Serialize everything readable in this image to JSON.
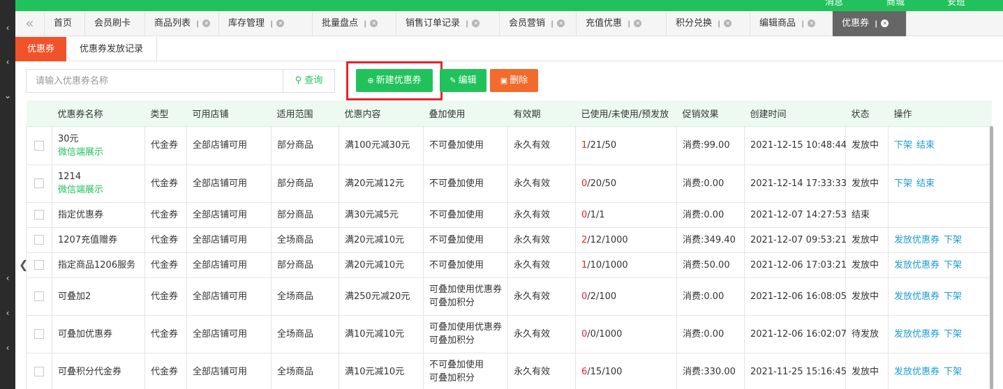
{
  "topbar": {
    "items": [
      "消息",
      "商城",
      "安班"
    ]
  },
  "tabs": [
    {
      "label": "首页",
      "closable": false
    },
    {
      "label": "会员刷卡",
      "closable": false
    },
    {
      "label": "商品列表",
      "closable": true
    },
    {
      "label": "库存管理",
      "closable": true
    },
    {
      "label": "批量盘点",
      "closable": true
    },
    {
      "label": "销售订单记录",
      "closable": true
    },
    {
      "label": "会员营销",
      "closable": true
    },
    {
      "label": "充值优惠",
      "closable": true
    },
    {
      "label": "积分兑换",
      "closable": true
    },
    {
      "label": "编辑商品",
      "closable": true
    },
    {
      "label": "优惠券",
      "closable": true,
      "active": true
    }
  ],
  "subtabs": [
    "优惠券",
    "优惠券发放记录"
  ],
  "search": {
    "placeholder": "请输入优惠券名称",
    "button": "查询"
  },
  "actions": {
    "create": "新建优惠券",
    "edit": "编辑",
    "delete": "删除"
  },
  "colors": {
    "green": "#21c25c",
    "orange": "#f26b2c",
    "red": "#e8242c",
    "link": "#1a9bd7"
  },
  "table": {
    "headers": [
      "优惠券名称",
      "类型",
      "可用店铺",
      "适用范围",
      "优惠内容",
      "叠加使用",
      "有效期",
      "已使用/未使用/预发放",
      "促销效果",
      "创建时间",
      "状态",
      "操作"
    ],
    "rows": [
      {
        "name": "30元",
        "sub": "微信端展示",
        "type": "代金券",
        "store": "全部店铺可用",
        "scope": "部分商品",
        "content": "满100元减30元",
        "stack": [
          "不可叠加使用"
        ],
        "validity": "永久有效",
        "used": "1",
        "rest": "/21/50",
        "effect": "消费:99.00",
        "created": "2021-12-15 10:48:44",
        "status": "发放中",
        "ops": [
          "下架",
          "结束"
        ]
      },
      {
        "name": "1214",
        "sub": "微信端展示",
        "type": "代金券",
        "store": "全部店铺可用",
        "scope": "部分商品",
        "content": "满20元减12元",
        "stack": [
          "不可叠加使用"
        ],
        "validity": "永久有效",
        "used": "0",
        "rest": "/20/50",
        "effect": "消费:0.00",
        "created": "2021-12-14 17:33:33",
        "status": "发放中",
        "ops": [
          "下架",
          "结束"
        ]
      },
      {
        "name": "指定优惠券",
        "sub": "",
        "type": "代金券",
        "store": "全部店铺可用",
        "scope": "部分商品",
        "content": "满30元减5元",
        "stack": [
          "不可叠加使用"
        ],
        "validity": "永久有效",
        "used": "0",
        "rest": "/1/1",
        "effect": "消费:0.00",
        "created": "2021-12-07 14:27:53",
        "status": "结束",
        "ops": []
      },
      {
        "name": "1207充值赠券",
        "sub": "",
        "type": "代金券",
        "store": "全部店铺可用",
        "scope": "全场商品",
        "content": "满20元减10元",
        "stack": [
          "不可叠加使用"
        ],
        "validity": "永久有效",
        "used": "2",
        "rest": "/12/1000",
        "effect": "消费:349.40",
        "created": "2021-12-07 09:53:21",
        "status": "发放中",
        "ops": [
          "发放优惠券",
          "下架"
        ]
      },
      {
        "name": "指定商品1206服务",
        "sub": "",
        "type": "代金券",
        "store": "全部店铺可用",
        "scope": "部分商品",
        "content": "满20元减10元",
        "stack": [
          "不可叠加使用"
        ],
        "validity": "永久有效",
        "used": "1",
        "rest": "/10/1000",
        "effect": "消费:50.00",
        "created": "2021-12-06 17:03:21",
        "status": "发放中",
        "ops": [
          "发放优惠券",
          "下架"
        ]
      },
      {
        "name": "可叠加2",
        "sub": "",
        "type": "代金券",
        "store": "全部店铺可用",
        "scope": "全场商品",
        "content": "满250元减20元",
        "stack": [
          "可叠加使用优惠券",
          "可叠加积分"
        ],
        "validity": "永久有效",
        "used": "0",
        "rest": "/2/100",
        "effect": "消费:0.00",
        "created": "2021-12-06 16:08:05",
        "status": "发放中",
        "ops": [
          "发放优惠券",
          "下架"
        ]
      },
      {
        "name": "可叠加优惠券",
        "sub": "",
        "type": "代金券",
        "store": "全部店铺可用",
        "scope": "全场商品",
        "content": "满10元减10元",
        "stack": [
          "可叠加使用优惠券",
          "可叠加积分"
        ],
        "validity": "永久有效",
        "used": "0",
        "rest": "/0/1000",
        "effect": "消费:0.00",
        "created": "2021-12-06 16:02:07",
        "status": "待发放",
        "ops": [
          "发放优惠券",
          "下架"
        ]
      },
      {
        "name": "可叠积分代金券",
        "sub": "",
        "type": "代金券",
        "store": "全部店铺可用",
        "scope": "全场商品",
        "content": "满10元减10元",
        "stack": [
          "不可叠加使用",
          "可叠加积分"
        ],
        "validity": "永久有效",
        "used": "6",
        "rest": "/15/100",
        "effect": "消费:330.00",
        "created": "2021-11-25 15:16:45",
        "status": "发放中",
        "ops": [
          "发放优惠券",
          "下架"
        ]
      }
    ]
  }
}
